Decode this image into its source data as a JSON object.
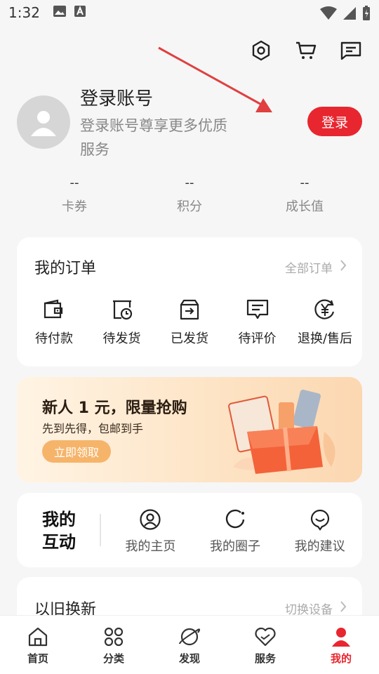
{
  "status": {
    "time": "1:32"
  },
  "profile": {
    "title": "登录账号",
    "subtitle": "登录账号尊享更多优质服务",
    "login_label": "登录"
  },
  "stats": [
    {
      "value": "--",
      "label": "卡券"
    },
    {
      "value": "--",
      "label": "积分"
    },
    {
      "value": "--",
      "label": "成长值"
    }
  ],
  "orders": {
    "title": "我的订单",
    "all_link": "全部订单",
    "items": [
      {
        "label": "待付款",
        "icon": "wallet-icon"
      },
      {
        "label": "待发货",
        "icon": "calendar-clock-icon"
      },
      {
        "label": "已发货",
        "icon": "box-arrow-icon"
      },
      {
        "label": "待评价",
        "icon": "comment-icon"
      },
      {
        "label": "退换/售后",
        "icon": "yen-icon"
      }
    ]
  },
  "banner": {
    "title": "新人 1 元，限量抢购",
    "subtitle": "先到先得，包邮到手",
    "button": "立即领取"
  },
  "interaction": {
    "title": "我的互动",
    "items": [
      {
        "label": "我的主页",
        "icon": "user-circle-icon"
      },
      {
        "label": "我的圈子",
        "icon": "circle-icon"
      },
      {
        "label": "我的建议",
        "icon": "smile-bubble-icon"
      }
    ]
  },
  "tradein": {
    "title": "以旧换新",
    "link": "切换设备"
  },
  "tabs": [
    {
      "label": "首页",
      "icon": "home-icon"
    },
    {
      "label": "分类",
      "icon": "category-icon"
    },
    {
      "label": "发现",
      "icon": "planet-icon"
    },
    {
      "label": "服务",
      "icon": "heart-icon"
    },
    {
      "label": "我的",
      "icon": "person-icon",
      "active": true
    }
  ],
  "colors": {
    "accent": "#e8262f",
    "banner_button": "#f6b46a"
  }
}
